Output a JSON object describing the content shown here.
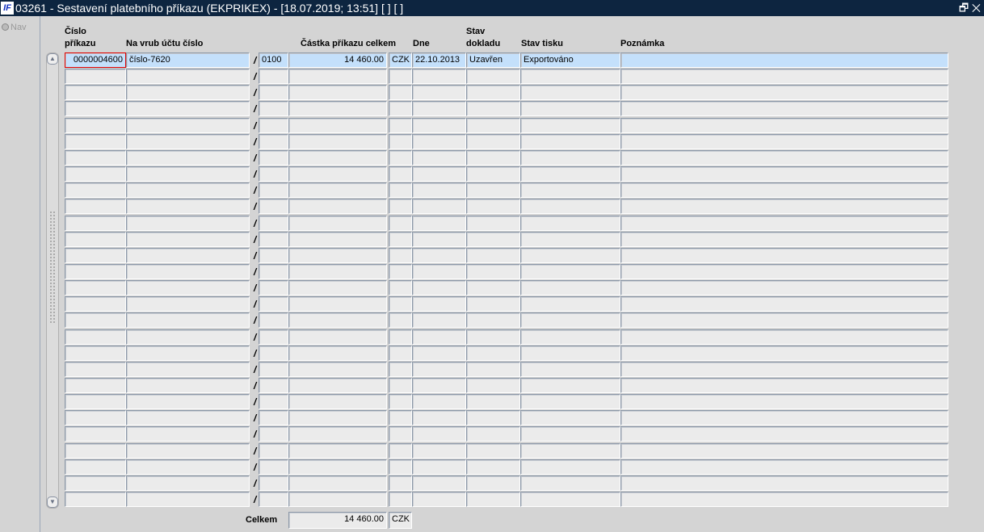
{
  "window": {
    "logo": "IF",
    "title": "03261 - Sestavení platebního příkazu (EKPRIKEX) - [18.07.2019; 13:51]  [ ]  [ ]",
    "restore_icon": "restore-icon",
    "close_icon": "close-icon",
    "controls": "🗗✕"
  },
  "sidebar": {
    "nav_label": "Nav"
  },
  "headers": {
    "cislo": [
      "Číslo",
      "příkazu"
    ],
    "ucet": "Na vrub účtu číslo",
    "castka": "Částka příkazu celkem",
    "dne": "Dne",
    "stav_dokladu": [
      "Stav",
      "dokladu"
    ],
    "stav_tisku": "Stav tisku",
    "poznamka": "Poznámka"
  },
  "row_count": 28,
  "rows": [
    {
      "cislo": "0000004600",
      "ucet": "číslo-7620",
      "banka": "0100",
      "castka": "14 460.00",
      "mena": "CZK",
      "dne": "22.10.2013",
      "stav_dokladu": "Uzavřen",
      "stav_tisku": "Exportováno",
      "poznamka": ""
    }
  ],
  "slash": "/",
  "footer": {
    "label": "Celkem",
    "total": "14 460.00",
    "currency": "CZK"
  },
  "colors": {
    "titlebar": "#0d2540",
    "selected_row": "#c4e0fb",
    "focus": "#e00000"
  }
}
